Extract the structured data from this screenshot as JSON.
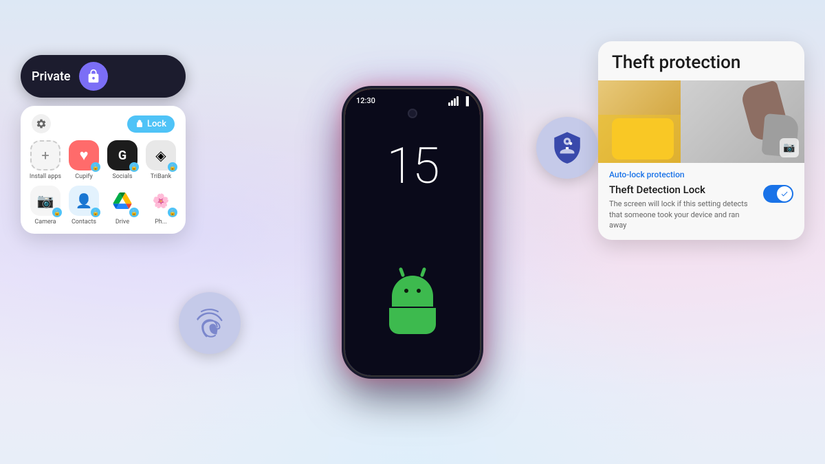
{
  "background": {
    "gradient_desc": "soft lavender-blue-pink gradient"
  },
  "phone": {
    "time": "12:30",
    "clock_number": "15",
    "android_version": "Android 15"
  },
  "private_panel": {
    "toggle_label": "Private",
    "lock_button_label": "Lock",
    "top_bar_gear": "⚙",
    "apps": [
      {
        "name": "Install apps",
        "icon": "+",
        "style": "install"
      },
      {
        "name": "Cupify",
        "icon": "❤",
        "style": "cupify",
        "has_lock": true
      },
      {
        "name": "Socials",
        "icon": "G",
        "style": "socials",
        "has_lock": true
      },
      {
        "name": "TriBank",
        "icon": "📊",
        "style": "tribank",
        "has_lock": true
      },
      {
        "name": "Camera",
        "icon": "📷",
        "style": "camera",
        "has_lock": true
      },
      {
        "name": "Contacts",
        "icon": "👤",
        "style": "contacts",
        "has_lock": true
      },
      {
        "name": "Drive",
        "icon": "△",
        "style": "drive",
        "has_lock": true
      },
      {
        "name": "Photos",
        "icon": "✿",
        "style": "photos",
        "has_lock": true
      }
    ]
  },
  "key_bubble": {
    "icon": "key-shield",
    "color": "#c5cae9"
  },
  "fingerprint_bubble": {
    "icon": "fingerprint",
    "color": "#c5cae9"
  },
  "theft_card": {
    "title": "Theft protection",
    "auto_lock_label": "Auto-lock protection",
    "detection_lock_title": "Theft Detection Lock",
    "detection_lock_desc": "The screen will lock if this setting detects that someone took your device and ran away",
    "toggle_enabled": true
  }
}
